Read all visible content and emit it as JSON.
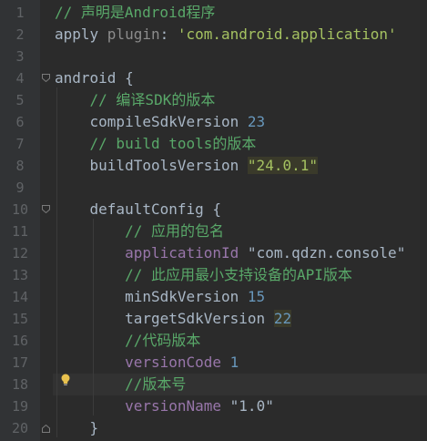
{
  "editor": {
    "line_numbers": [
      "1",
      "2",
      "3",
      "4",
      "5",
      "6",
      "7",
      "8",
      "9",
      "10",
      "11",
      "12",
      "13",
      "14",
      "15",
      "16",
      "17",
      "18",
      "19",
      "20"
    ],
    "lines": [
      [
        {
          "t": "// 声明是Android程序",
          "c": "tok-comment"
        }
      ],
      [
        {
          "t": "apply ",
          "c": "tok-plain"
        },
        {
          "t": "plugin",
          "c": "tok-param"
        },
        {
          "t": ": ",
          "c": "tok-plain"
        },
        {
          "t": "'com.android.application'",
          "c": "tok-str"
        }
      ],
      [],
      [
        {
          "t": "android {",
          "c": "tok-plain"
        }
      ],
      [
        {
          "t": "    ",
          "c": "tok-plain"
        },
        {
          "t": "// 编译SDK的版本",
          "c": "tok-comment"
        }
      ],
      [
        {
          "t": "    compileSdkVersion ",
          "c": "tok-plain"
        },
        {
          "t": "23",
          "c": "tok-num"
        }
      ],
      [
        {
          "t": "    ",
          "c": "tok-plain"
        },
        {
          "t": "// build tools的版本",
          "c": "tok-comment"
        }
      ],
      [
        {
          "t": "    buildToolsVersion ",
          "c": "tok-plain"
        },
        {
          "t": "\"24.0.1\"",
          "c": "tok-strhl"
        }
      ],
      [],
      [
        {
          "t": "    defaultConfig {",
          "c": "tok-plain"
        }
      ],
      [
        {
          "t": "        ",
          "c": "tok-plain"
        },
        {
          "t": "// 应用的包名",
          "c": "tok-comment"
        }
      ],
      [
        {
          "t": "        ",
          "c": "tok-plain"
        },
        {
          "t": "applicationId",
          "c": "tok-purple"
        },
        {
          "t": " \"com.qdzn.console\"",
          "c": "tok-plain"
        }
      ],
      [
        {
          "t": "        ",
          "c": "tok-plain"
        },
        {
          "t": "// 此应用最小支持设备的API版本",
          "c": "tok-comment"
        }
      ],
      [
        {
          "t": "        minSdkVersion ",
          "c": "tok-plain"
        },
        {
          "t": "15",
          "c": "tok-num"
        }
      ],
      [
        {
          "t": "        targetSdkVersion ",
          "c": "tok-plain"
        },
        {
          "t": "22",
          "c": "tok-numhl"
        }
      ],
      [
        {
          "t": "        ",
          "c": "tok-plain"
        },
        {
          "t": "//代码版本",
          "c": "tok-comment"
        }
      ],
      [
        {
          "t": "        ",
          "c": "tok-plain"
        },
        {
          "t": "versionCode",
          "c": "tok-purple"
        },
        {
          "t": " ",
          "c": "tok-plain"
        },
        {
          "t": "1",
          "c": "tok-num"
        }
      ],
      [
        {
          "t": "        ",
          "c": "tok-plain"
        },
        {
          "t": "//版本号",
          "c": "tok-comment"
        }
      ],
      [
        {
          "t": "        ",
          "c": "tok-plain"
        },
        {
          "t": "versionName",
          "c": "tok-purple"
        },
        {
          "t": " \"1.0\"",
          "c": "tok-plain"
        }
      ],
      [
        {
          "t": "    }",
          "c": "tok-plain"
        }
      ]
    ],
    "highlighted_line": 18,
    "icons": {
      "fold": "fold-marker-icon",
      "bulb": "lightbulb-icon"
    }
  },
  "colors": {
    "background": "#2b2b2b",
    "gutter": "#313335",
    "comment": "#59a869",
    "string": "#a5c261",
    "number": "#6897bb",
    "field": "#9876aa"
  }
}
